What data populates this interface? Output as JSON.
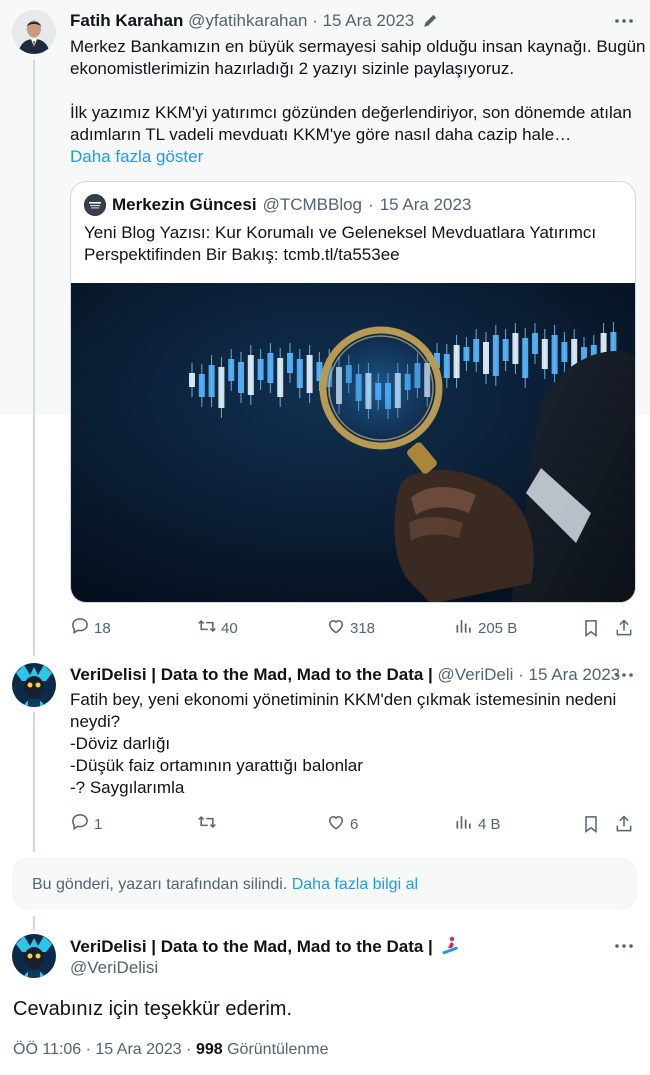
{
  "tweet1": {
    "display_name": "Fatih Karahan",
    "handle": "@yfatihkarahan",
    "sep": "·",
    "date": "15 Ara 2023",
    "text_line1": "Merkez Bankamızın en büyük sermayesi sahip olduğu insan kaynağı. Bugün",
    "text_line2": "ekonomistlerimizin hazırladığı 2 yazıyı sizinle paylaşıyoruz.",
    "text_line3": "İlk yazımız KKM'yi yatırımcı gözünden değerlendiriyor, son dönemde atılan",
    "text_line4": "adımların TL vadeli mevduatı KKM'ye göre nasıl daha cazip hale…",
    "show_more": "Daha fazla göster",
    "quote": {
      "display_name": "Merkezin Güncesi",
      "handle": "@TCMBBlog",
      "sep": "·",
      "date": "15 Ara 2023",
      "logo_text": "MERKEZİN GÜNCESİ",
      "text_line1": "Yeni Blog Yazısı: Kur Korumalı ve Geleneksel Mevduatlara Yatırımcı",
      "text_line2": "Perspektifinden Bir Bakış: tcmb.tl/ta553ee"
    },
    "actions": {
      "replies": "18",
      "retweets": "40",
      "likes": "318",
      "views": "205 B"
    }
  },
  "tweet2": {
    "display_name": "VeriDelisi | Data to the Mad, Mad to the Data |",
    "handle": "@VeriDeli",
    "sep": "·",
    "date": "15 Ara 2023",
    "text_line1": "Fatih bey, yeni ekonomi yönetiminin KKM'den çıkmak istemesinin nedeni",
    "text_line2": "neydi?",
    "text_line3": "-Döviz darlığı",
    "text_line4": "-Düşük faiz ortamının yarattığı balonlar",
    "text_line5": "-? Saygılarımla",
    "actions": {
      "replies": "1",
      "retweets": "",
      "likes": "6",
      "views": "4 B"
    }
  },
  "deleted_notice": {
    "text": "Bu gönderi, yazarı tarafından silindi.",
    "link": "Daha fazla bilgi al"
  },
  "main_tweet": {
    "display_name": "VeriDelisi | Data to the Mad, Mad to the Data |",
    "handle": "@VeriDelisi",
    "text": "Cevabınız için teşekkür ederim.",
    "time": "ÖÖ 11:06 · 15 Ara 2023 ·",
    "views_count": "998",
    "views_label": "Görüntülenme"
  },
  "colors": {
    "accent": "#1d9bf0",
    "text": "#0f1419",
    "muted": "#536471",
    "border": "#cfd9de"
  },
  "icons": [
    "pencil-icon",
    "more-icon",
    "reply-icon",
    "retweet-icon",
    "like-icon",
    "views-icon",
    "bookmark-icon",
    "share-icon",
    "snowboard-emoji"
  ]
}
